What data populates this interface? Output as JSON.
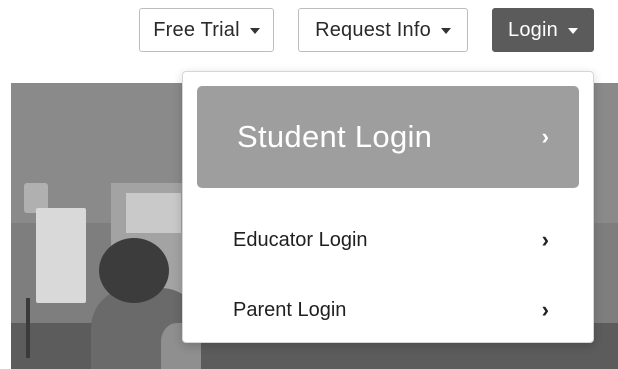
{
  "header": {
    "free_trial_label": "Free Trial",
    "request_info_label": "Request Info",
    "login_label": "Login"
  },
  "login_menu": {
    "items": [
      {
        "label": "Student Login",
        "chevron": "›",
        "highlighted": true
      },
      {
        "label": "Educator Login",
        "chevron": "›",
        "highlighted": false
      },
      {
        "label": "Parent Login",
        "chevron": "›",
        "highlighted": false
      }
    ]
  },
  "colors": {
    "login_button_bg": "#5b5b5b",
    "student_login_bg": "#9e9e9e",
    "menu_text": "#1f1f1f"
  },
  "icons": {
    "dropdown_caret": "caret-down-icon",
    "menu_chevron": "chevron-right-icon"
  }
}
